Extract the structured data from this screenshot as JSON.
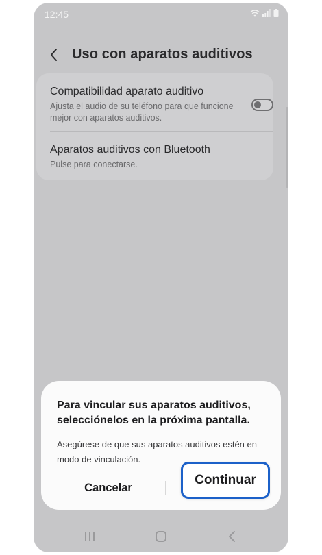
{
  "status_bar": {
    "time": "12:45"
  },
  "header": {
    "title": "Uso con aparatos auditivos",
    "back_icon": "chevron-left-icon"
  },
  "settings": {
    "items": [
      {
        "title": "Compatibilidad aparato auditivo",
        "subtitle": "Ajusta el audio de su teléfono para que funcione mejor con aparatos auditivos.",
        "toggle_on": false
      },
      {
        "title": "Aparatos auditivos con Bluetooth",
        "subtitle": "Pulse para conectarse."
      }
    ]
  },
  "dialog": {
    "title": "Para vincular sus aparatos auditivos, selecciónelos en la próxima pantalla.",
    "body": "Asegúrese de que sus aparatos auditivos estén en modo de vinculación.",
    "cancel_label": "Cancelar",
    "continue_label": "Continuar",
    "highlight_color": "#1c61c9"
  },
  "nav_bar": {
    "icons": [
      "recents-icon",
      "home-icon",
      "back-icon"
    ]
  }
}
